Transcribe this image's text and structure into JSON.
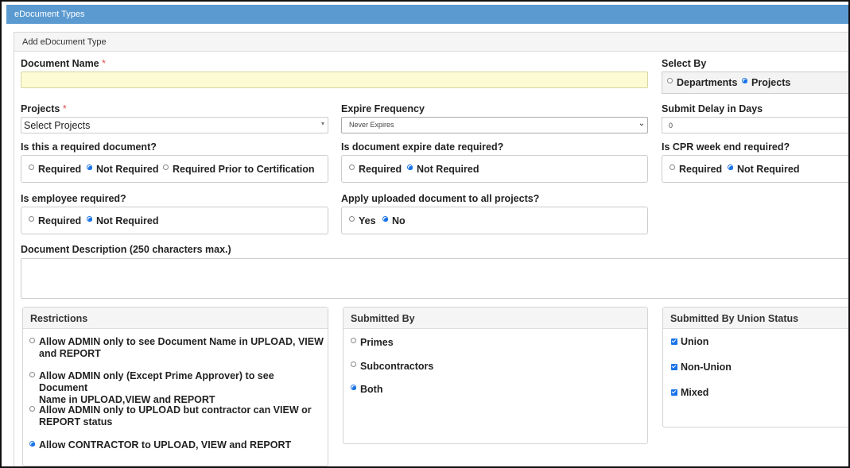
{
  "window": {
    "title": "eDocument Types"
  },
  "panel": {
    "title": "Add eDocument Type"
  },
  "document_name": {
    "label": "Document Name",
    "required_mark": "*",
    "value": ""
  },
  "select_by": {
    "label": "Select By",
    "options": [
      "Departments",
      "Projects"
    ],
    "selected": "Projects"
  },
  "projects": {
    "label": "Projects",
    "required_mark": "*",
    "value": "Select Projects"
  },
  "expire_frequency": {
    "label": "Expire Frequency",
    "value": "Never Expires"
  },
  "submit_delay": {
    "label": "Submit Delay in Days",
    "value": "0"
  },
  "required_document": {
    "label": "Is this a required document?",
    "options": [
      "Required",
      "Not Required",
      "Required Prior to Certification"
    ],
    "selected": "Not Required"
  },
  "expire_date_required": {
    "label": "Is document expire date required?",
    "options": [
      "Required",
      "Not Required"
    ],
    "selected": "Not Required"
  },
  "cpr_week_end_required": {
    "label": "Is CPR week end required?",
    "options": [
      "Required",
      "Not Required"
    ],
    "selected": "Not Required"
  },
  "employee_required": {
    "label": "Is employee required?",
    "options": [
      "Required",
      "Not Required"
    ],
    "selected": "Not Required"
  },
  "apply_all_projects": {
    "label": "Apply uploaded document to all projects?",
    "options": [
      "Yes",
      "No"
    ],
    "selected": "No"
  },
  "description": {
    "label": "Document Description (250 characters max.)",
    "value": ""
  },
  "restrictions": {
    "title": "Restrictions",
    "options": [
      {
        "line1": "Allow ADMIN only to see Document Name in UPLOAD, VIEW",
        "line2": "and REPORT"
      },
      {
        "line1": "Allow ADMIN only (Except Prime Approver) to see Document",
        "line2": "Name in UPLOAD,VIEW and REPORT"
      },
      {
        "line1": "Allow ADMIN only to UPLOAD but contractor can VIEW or",
        "line2": "REPORT status"
      },
      {
        "line1": "Allow CONTRACTOR to UPLOAD, VIEW and REPORT",
        "line2": ""
      }
    ],
    "selected_index": 3
  },
  "submitted_by": {
    "title": "Submitted By",
    "options": [
      "Primes",
      "Subcontractors",
      "Both"
    ],
    "selected": "Both"
  },
  "union_status": {
    "title": "Submitted By Union Status",
    "options": [
      {
        "label": "Union",
        "checked": true
      },
      {
        "label": "Non-Union",
        "checked": true
      },
      {
        "label": "Mixed",
        "checked": true
      }
    ]
  },
  "colors": {
    "titlebar": "#5a9ad0",
    "accent": "#1a73e8",
    "required": "#d9534f",
    "highlight_input": "#fdfbd3"
  }
}
